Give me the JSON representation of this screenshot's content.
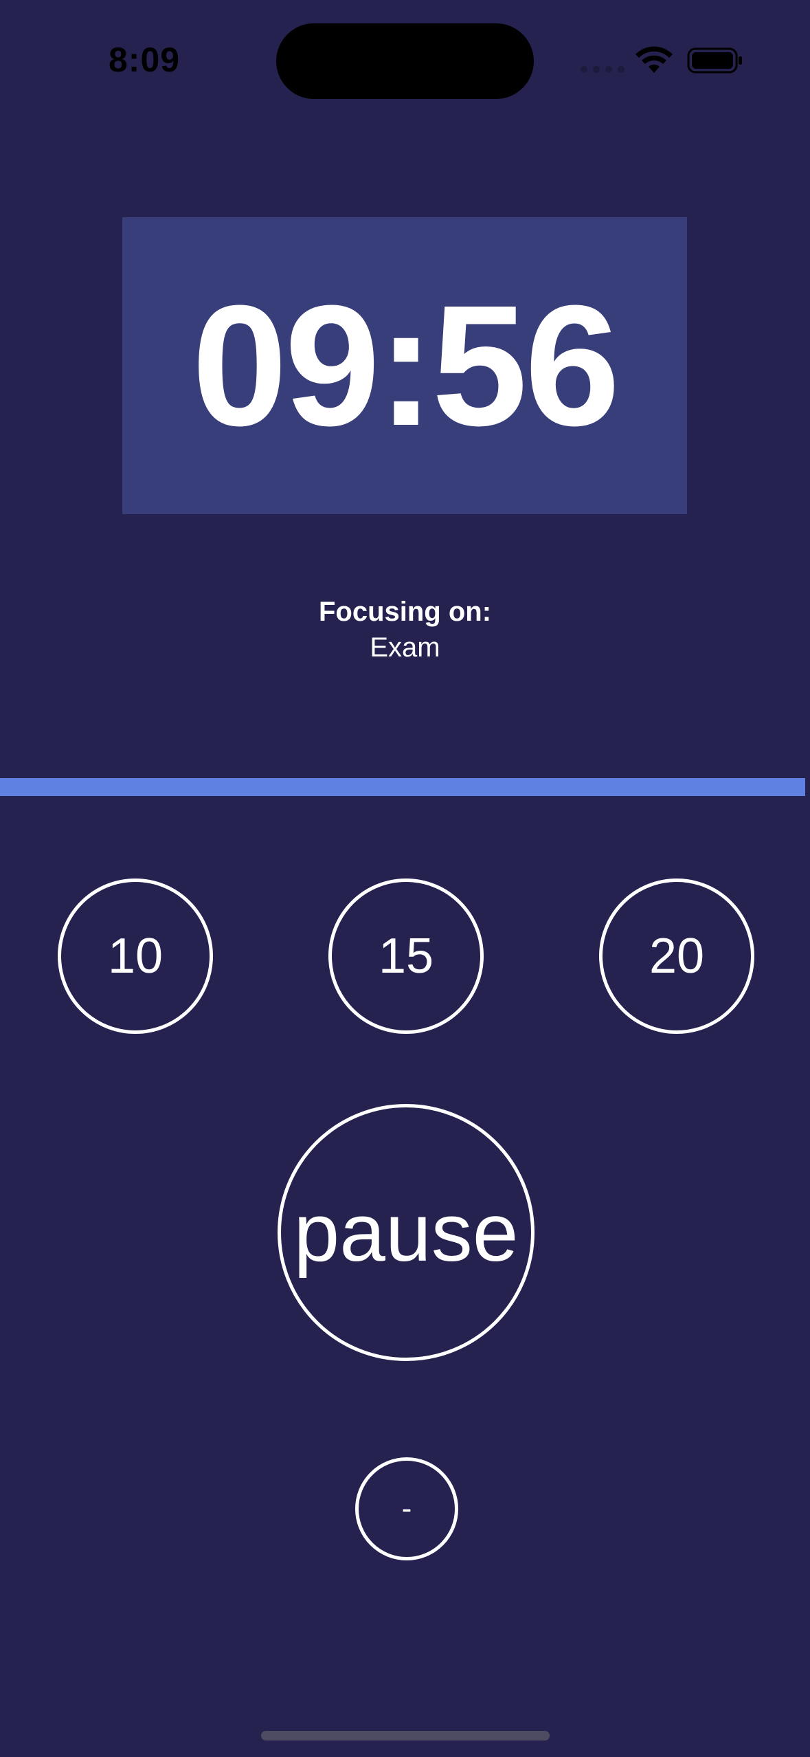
{
  "status_bar": {
    "time": "8:09"
  },
  "timer": {
    "display": "09:56"
  },
  "focus": {
    "label": "Focusing on:",
    "value": "Exam"
  },
  "progress": {
    "percent_complete": 99.4,
    "fill_color": "#5f82e2"
  },
  "presets": [
    {
      "label": "10"
    },
    {
      "label": "15"
    },
    {
      "label": "20"
    }
  ],
  "controls": {
    "pause_label": "pause",
    "minus_label": "-"
  },
  "colors": {
    "background": "#25224f",
    "timer_box": "#373e7a",
    "text": "#ffffff"
  }
}
